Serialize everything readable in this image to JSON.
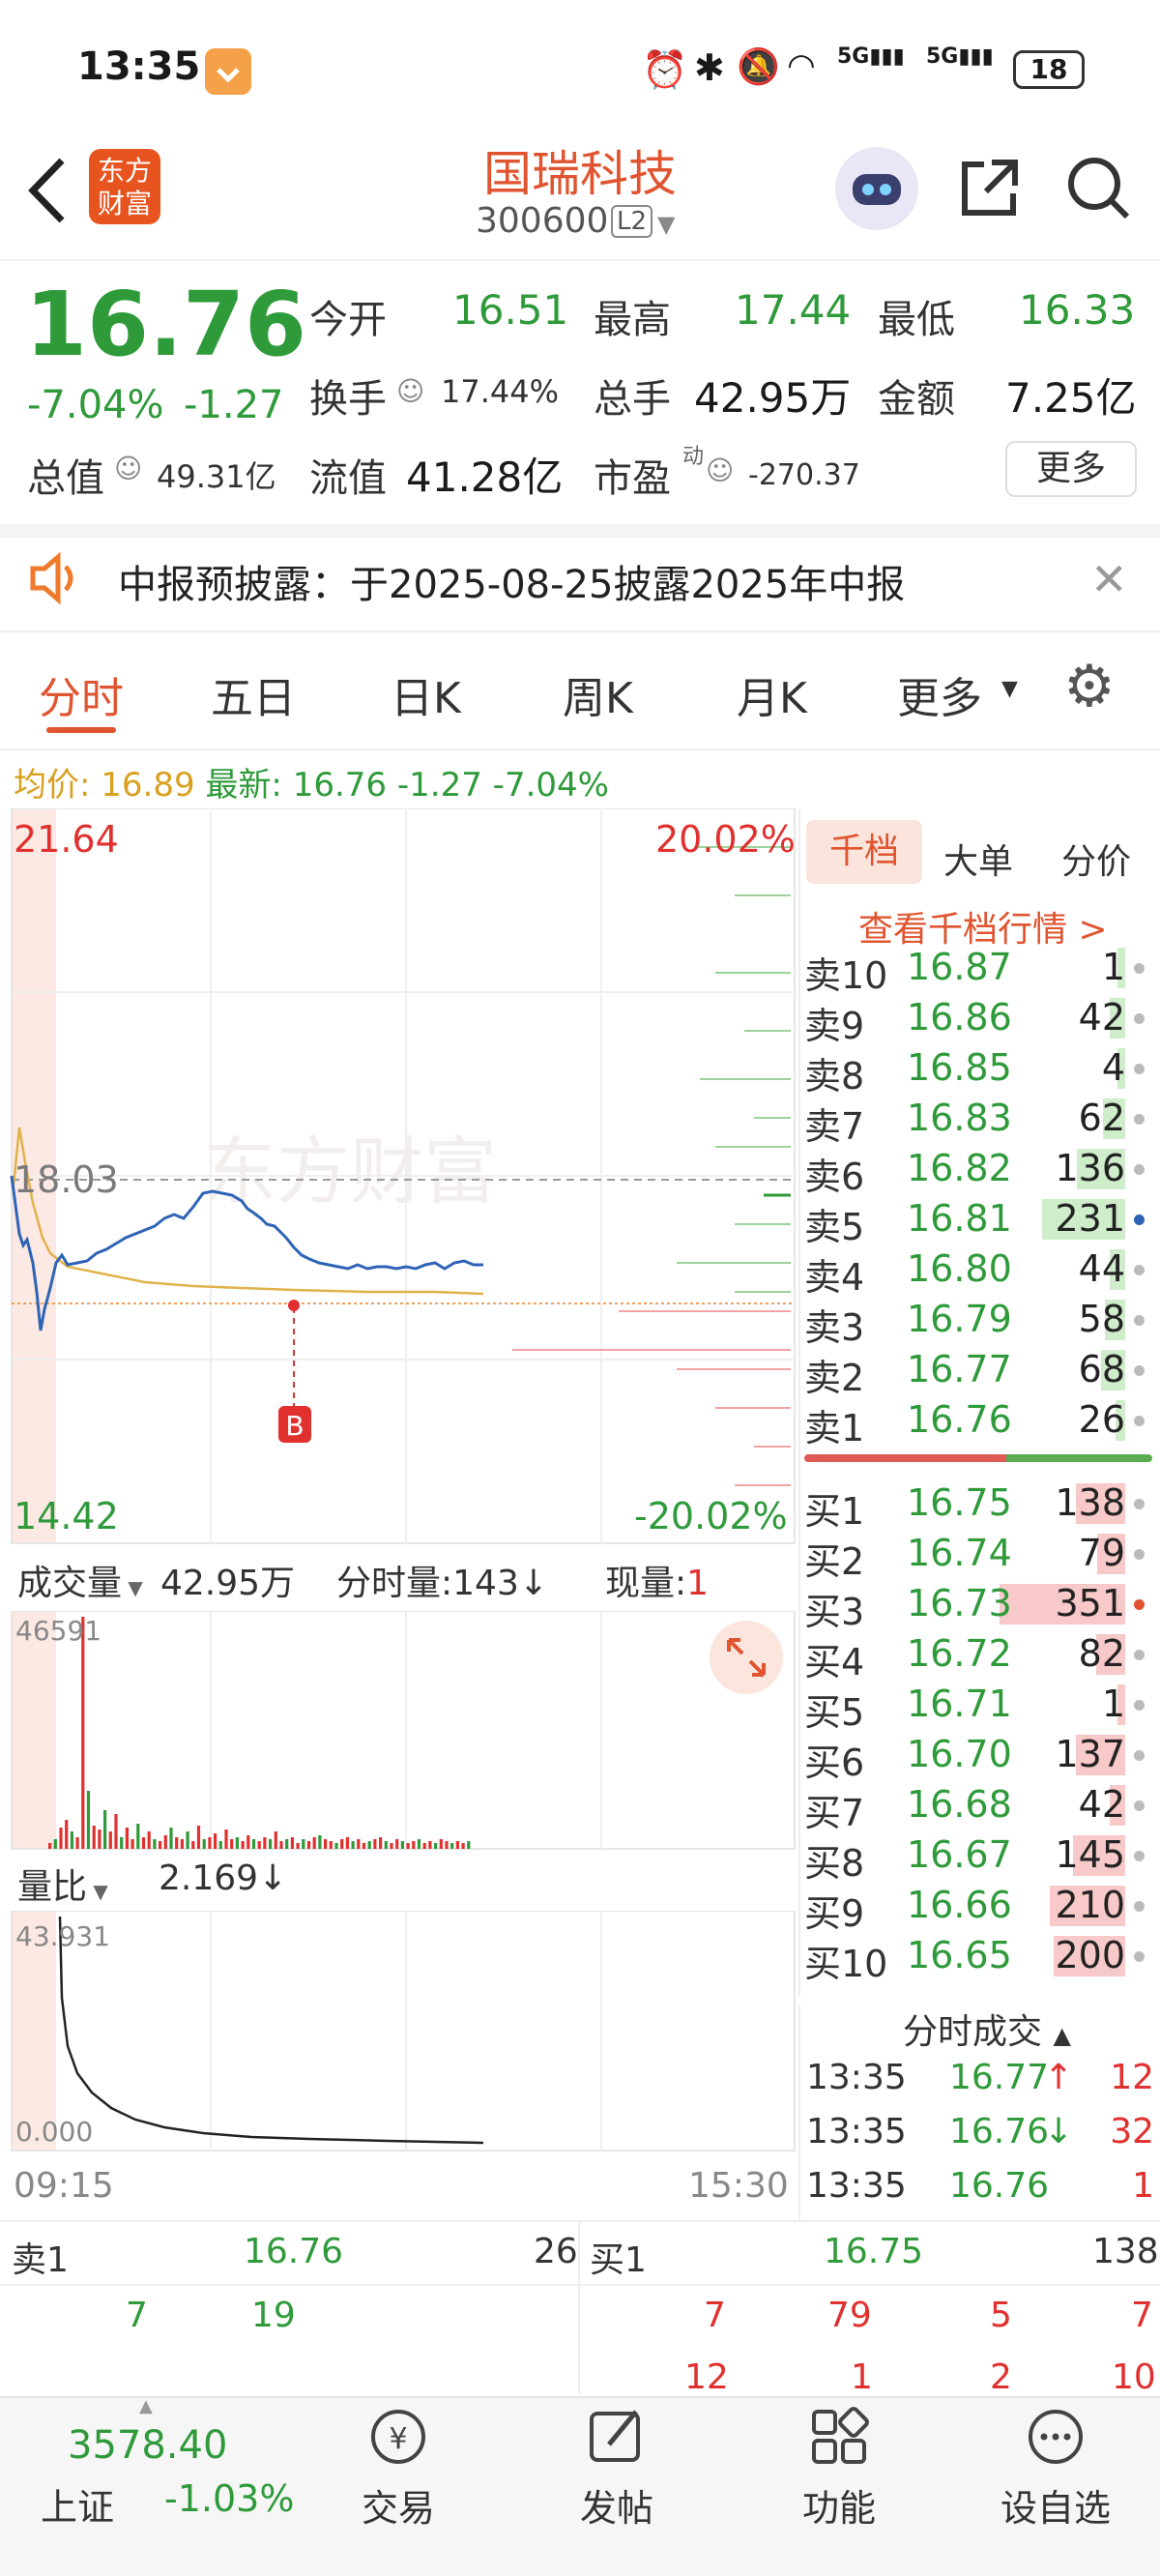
{
  "status_bar": {
    "time": "13:35",
    "battery": "18",
    "signal1": "5G",
    "signal2": "5G"
  },
  "header": {
    "logo_line1": "东方",
    "logo_line2": "财富",
    "stock_name": "国瑞科技",
    "stock_code": "300600",
    "level_badge": "L2"
  },
  "quote": {
    "price": "16.76",
    "change_pct": "-7.04%",
    "change": "-1.27",
    "open_label": "今开",
    "open": "16.51",
    "high_label": "最高",
    "high": "17.44",
    "low_label": "最低",
    "low": "16.33",
    "turnover_label": "换手",
    "turnover": "17.44%",
    "volume_label": "总手",
    "volume": "42.95万",
    "amount_label": "金额",
    "amount": "7.25亿",
    "mktcap_label": "总值",
    "mktcap": "49.31亿",
    "float_label": "流值",
    "float_cap": "41.28亿",
    "pe_label": "市盈",
    "pe_sup": "动",
    "pe": "-270.37",
    "more_button": "更多"
  },
  "notice": {
    "text": "中报预披露：于2025-08-25披露2025年中报"
  },
  "tabs": [
    {
      "label": "分时",
      "active": true
    },
    {
      "label": "五日"
    },
    {
      "label": "日K"
    },
    {
      "label": "周K"
    },
    {
      "label": "月K"
    },
    {
      "label": "更多"
    }
  ],
  "info_line": {
    "avg_label": "均价:",
    "avg": "16.89",
    "latest_label": "最新:",
    "latest": "16.76",
    "change": "-1.27",
    "pct": "-7.04%"
  },
  "price_chart": {
    "top_price": "21.64",
    "top_pct": "20.02%",
    "mid_price": "18.03",
    "bottom_price": "14.42",
    "bottom_pct": "-20.02%",
    "marker": "B",
    "watermark": "东方财富"
  },
  "volume_panel": {
    "label": "成交量",
    "total": "42.95万",
    "minute_label": "分时量:",
    "minute_value": "143",
    "arrow": "↓",
    "current_label": "现量:",
    "current_value": "1",
    "max_value": "46591"
  },
  "ratio_panel": {
    "label": "量比",
    "value": "2.169",
    "arrow": "↓",
    "max_value": "43.931",
    "min_value": "0.000"
  },
  "time_axis": {
    "start": "09:15",
    "end": "15:30"
  },
  "order_book": {
    "tabs": [
      "千档",
      "大单",
      "分价"
    ],
    "link": "查看千档行情 >",
    "asks": [
      {
        "label": "卖10",
        "price": "16.87",
        "volume": "1"
      },
      {
        "label": "卖9",
        "price": "16.86",
        "volume": "42"
      },
      {
        "label": "卖8",
        "price": "16.85",
        "volume": "4"
      },
      {
        "label": "卖7",
        "price": "16.83",
        "volume": "62"
      },
      {
        "label": "卖6",
        "price": "16.82",
        "volume": "136"
      },
      {
        "label": "卖5",
        "price": "16.81",
        "volume": "231"
      },
      {
        "label": "卖4",
        "price": "16.80",
        "volume": "44"
      },
      {
        "label": "卖3",
        "price": "16.79",
        "volume": "58"
      },
      {
        "label": "卖2",
        "price": "16.77",
        "volume": "68"
      },
      {
        "label": "卖1",
        "price": "16.76",
        "volume": "26"
      }
    ],
    "bids": [
      {
        "label": "买1",
        "price": "16.75",
        "volume": "138"
      },
      {
        "label": "买2",
        "price": "16.74",
        "volume": "79"
      },
      {
        "label": "买3",
        "price": "16.73",
        "volume": "351"
      },
      {
        "label": "买4",
        "price": "16.72",
        "volume": "82"
      },
      {
        "label": "买5",
        "price": "16.71",
        "volume": "1"
      },
      {
        "label": "买6",
        "price": "16.70",
        "volume": "137"
      },
      {
        "label": "买7",
        "price": "16.68",
        "volume": "42"
      },
      {
        "label": "买8",
        "price": "16.67",
        "volume": "145"
      },
      {
        "label": "买9",
        "price": "16.66",
        "volume": "210"
      },
      {
        "label": "买10",
        "price": "16.65",
        "volume": "200"
      }
    ]
  },
  "trades": {
    "title": "分时成交",
    "rows": [
      {
        "time": "13:35",
        "price": "16.77",
        "arrow": "↑",
        "volume": "12",
        "dir": "up"
      },
      {
        "time": "13:35",
        "price": "16.76",
        "arrow": "↓",
        "volume": "32",
        "dir": "down"
      },
      {
        "time": "13:35",
        "price": "16.76",
        "arrow": "",
        "volume": "1",
        "dir": "down"
      }
    ]
  },
  "bottom_book": {
    "sell_label": "卖1",
    "sell_price": "16.76",
    "sell_volume": "26",
    "buy_label": "买1",
    "buy_price": "16.75",
    "buy_volume": "138",
    "sell_queue": [
      "7",
      "19"
    ],
    "buy_queue_row1": [
      "7",
      "79",
      "5",
      "7"
    ],
    "buy_queue_row2": [
      "12",
      "1",
      "2",
      "10"
    ]
  },
  "nav": {
    "index_value": "3578.40",
    "index_name": "上证",
    "index_change": "-1.03%",
    "items": [
      "交易",
      "发帖",
      "功能",
      "设自选"
    ]
  }
}
